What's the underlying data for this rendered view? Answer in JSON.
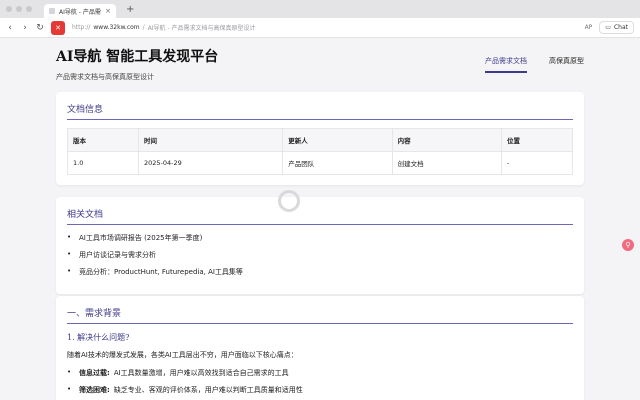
{
  "browser": {
    "tab_title": "AI导航 - 产品需求文档&",
    "tab_close": "×",
    "new_tab": "+",
    "nav_back": "‹",
    "nav_forward": "›",
    "nav_reload": "↻",
    "site_icon": "✕",
    "url_scheme": "http://",
    "url_domain": "www.32kw.com",
    "url_sep": "/",
    "url_path": "AI导航 - 产品需求文档与高保真原型设计",
    "ap": "AP",
    "chat": "Chat",
    "chat_icon": "▭"
  },
  "header": {
    "title": "AI导航 智能工具发现平台",
    "subtitle": "产品需求文档与高保真原型设计",
    "nav": [
      "产品需求文档",
      "高保真原型"
    ]
  },
  "doc_info": {
    "title": "文档信息",
    "columns": [
      "版本",
      "时间",
      "更新人",
      "内容",
      "位置"
    ],
    "rows": [
      [
        "1.0",
        "2025-04-29",
        "产品团队",
        "创建文档",
        "-"
      ]
    ]
  },
  "related": {
    "title": "相关文档",
    "items": [
      "AI工具市场调研报告 (2025年第一季度)",
      "用户访谈记录与需求分析",
      "竞品分析：ProductHunt, Futurepedia, AI工具集等"
    ]
  },
  "section1": {
    "title": "一、需求背景",
    "h2": "1. 解决什么问题?",
    "intro": "随着AI技术的爆发式发展，各类AI工具层出不穷，用户面临以下核心痛点：",
    "points": [
      {
        "label": "信息过载:",
        "text": "AI工具数量激增，用户难以高效找到适合自己需求的工具"
      },
      {
        "label": "筛选困难:",
        "text": "缺乏专业、客观的评价体系，用户难以判断工具质量和适用性"
      }
    ]
  },
  "bullet": "•",
  "float_icon": "⚲"
}
